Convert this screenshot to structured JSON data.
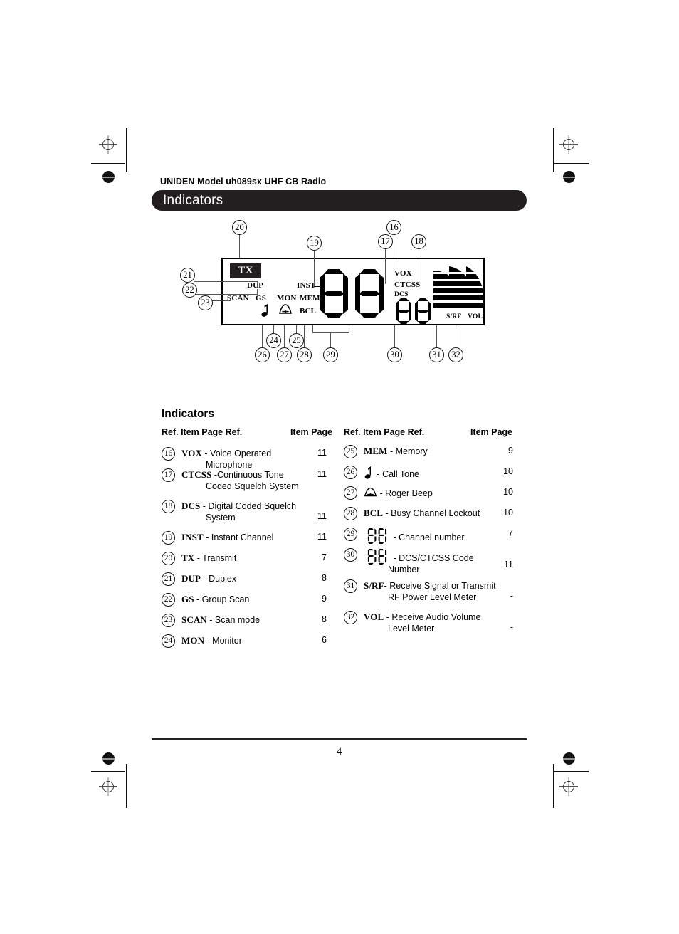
{
  "document": {
    "header_kicker": "UNIDEN Model uh089sx UHF CB Radio",
    "section_title": "Indicators",
    "subsection_title": "Indicators",
    "page_number": "4"
  },
  "lcd_diagram": {
    "tx_badge": "TX",
    "labels": {
      "dup": "DUP",
      "scan": "SCAN",
      "gs": "GS",
      "mon": "MON",
      "mem": "MEM",
      "bcl": "BCL",
      "inst": "INST",
      "vox": "VOX",
      "ctcss": "CTCSS",
      "dcs": "DCS",
      "srf": "S/RF",
      "vol": "VOL"
    },
    "channel_display": "88",
    "code_display": "88",
    "callouts": [
      "16",
      "17",
      "18",
      "19",
      "20",
      "21",
      "22",
      "23",
      "24",
      "25",
      "26",
      "27",
      "28",
      "29",
      "30",
      "31",
      "32"
    ]
  },
  "table": {
    "headers": {
      "left": "Ref. Item Page Ref.",
      "left_right": "Item Page",
      "right": "Ref. Item Page Ref.",
      "right_right": "Item Page"
    },
    "left_column": [
      {
        "ref": "16",
        "term": "VOX",
        "sep": " - ",
        "desc": "Voice Operated",
        "cont": "Microphone",
        "page": "11"
      },
      {
        "ref": "17",
        "term": "CTCSS",
        "sep": " -",
        "desc": "Continuous Tone",
        "cont": "Coded Squelch System",
        "page": "11"
      },
      {
        "ref": "18",
        "term": "DCS",
        "sep": " - ",
        "desc": "Digital Coded Squelch",
        "cont": "System",
        "page": "11"
      },
      {
        "ref": "19",
        "term": "INST",
        "sep": " - ",
        "desc": "Instant Channel",
        "cont": "",
        "page": "11"
      },
      {
        "ref": "20",
        "term": "TX",
        "sep": " - ",
        "desc": "Transmit",
        "cont": "",
        "page": "7"
      },
      {
        "ref": "21",
        "term": "DUP",
        "sep": " - ",
        "desc": "Duplex",
        "cont": "",
        "page": "8"
      },
      {
        "ref": "22",
        "term": "GS",
        "sep": " - ",
        "desc": "Group Scan",
        "cont": "",
        "page": "9"
      },
      {
        "ref": "23",
        "term": "SCAN",
        "sep": " - ",
        "desc": "Scan mode",
        "cont": "",
        "page": "8"
      },
      {
        "ref": "24",
        "term": "MON",
        "sep": " - ",
        "desc": "Monitor",
        "cont": "",
        "page": "6"
      }
    ],
    "right_column": [
      {
        "ref": "25",
        "term": "MEM",
        "sep": " - ",
        "desc": "Memory",
        "cont": "",
        "page": "9",
        "icon": ""
      },
      {
        "ref": "26",
        "term": "",
        "sep": " - ",
        "desc": "Call Tone",
        "cont": "",
        "page": "10",
        "icon": "music-note-icon"
      },
      {
        "ref": "27",
        "term": "",
        "sep": " - ",
        "desc": "Roger Beep",
        "cont": "",
        "page": "10",
        "icon": "bell-icon"
      },
      {
        "ref": "28",
        "term": "BCL",
        "sep": " - ",
        "desc": "Busy Channel Lockout",
        "cont": "",
        "page": "10",
        "icon": ""
      },
      {
        "ref": "29",
        "term": "",
        "sep": " - ",
        "desc": "Channel number",
        "cont": "",
        "page": "7",
        "icon": "seven-segment-88-icon"
      },
      {
        "ref": "30",
        "term": "",
        "sep": " -  ",
        "desc": "DCS/CTCSS Code",
        "cont": "Number",
        "page": "11",
        "icon": "seven-segment-88-icon"
      },
      {
        "ref": "31",
        "term": "S/RF",
        "sep": "- ",
        "desc": "Receive Signal or Transmit",
        "cont": "RF Power Level Meter",
        "page": "-",
        "icon": ""
      },
      {
        "ref": "32",
        "term": "VOL",
        "sep": " - ",
        "desc": "Receive Audio Volume",
        "cont": "Level Meter",
        "page": "-",
        "icon": ""
      }
    ]
  },
  "colors": {
    "ink": "#231f20",
    "leader": "#555555",
    "paper": "#ffffff"
  }
}
